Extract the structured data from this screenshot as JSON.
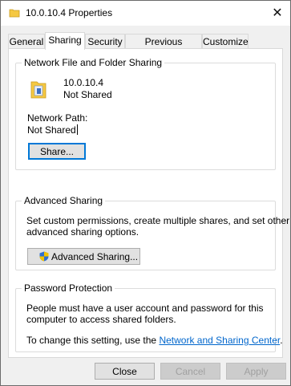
{
  "window": {
    "title": "10.0.10.4 Properties"
  },
  "tabs": [
    {
      "label": "General"
    },
    {
      "label": "Sharing"
    },
    {
      "label": "Security"
    },
    {
      "label": "Previous Versions"
    },
    {
      "label": "Customize"
    }
  ],
  "network_sharing": {
    "group_title": "Network File and Folder Sharing",
    "item_name": "10.0.10.4",
    "item_status": "Not Shared",
    "path_label": "Network Path:",
    "path_value": "Not Shared",
    "share_button": "Share..."
  },
  "advanced_sharing": {
    "group_title": "Advanced Sharing",
    "description": [
      "Set custom permissions, create multiple shares, and set other",
      "advanced sharing options."
    ],
    "button": "Advanced Sharing..."
  },
  "password_protection": {
    "group_title": "Password Protection",
    "description": [
      "People must have a user account and password for this",
      "computer to access shared folders."
    ],
    "change_prefix": "To change this setting, use the ",
    "link": "Network and Sharing Center",
    "change_suffix": "."
  },
  "footer": {
    "close": "Close",
    "cancel": "Cancel",
    "apply": "Apply"
  },
  "colors": {
    "accent": "#0078d7",
    "link": "#0066cc",
    "folder": "#f5c842"
  }
}
